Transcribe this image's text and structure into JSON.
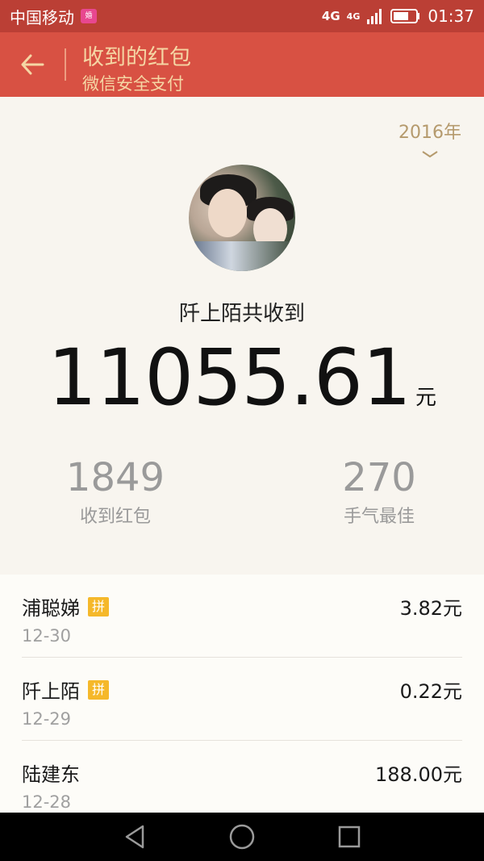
{
  "status_bar": {
    "carrier": "中国移动",
    "carrier_badge": "婚",
    "network_1": "4G",
    "network_2": "4G",
    "time": "01:37"
  },
  "app_bar": {
    "title": "收到的红包",
    "subtitle": "微信安全支付"
  },
  "summary": {
    "year": "2016年",
    "user_label": "阡上陌共收到",
    "total_amount": "11055.61",
    "unit": "元",
    "stats": [
      {
        "value": "1849",
        "label": "收到红包"
      },
      {
        "value": "270",
        "label": "手气最佳"
      }
    ]
  },
  "records": [
    {
      "name": "浦聪娣",
      "badge": "拼",
      "date": "12-30",
      "amount": "3.82元"
    },
    {
      "name": "阡上陌",
      "badge": "拼",
      "date": "12-29",
      "amount": "0.22元"
    },
    {
      "name": "陆建东",
      "badge": "",
      "date": "12-28",
      "amount": "188.00元"
    }
  ],
  "colors": {
    "status_bar": "#bb3f35",
    "app_bar": "#d85143",
    "title_text": "#f5d6a4",
    "background": "#f8f5ef",
    "year_text": "#b59a6d",
    "pin_badge": "#f5b82a"
  },
  "icons": {
    "back": "arrow-left-icon",
    "year_toggle": "chevron-down-icon",
    "nav": [
      "triangle-back-icon",
      "circle-home-icon",
      "square-recents-icon"
    ]
  }
}
